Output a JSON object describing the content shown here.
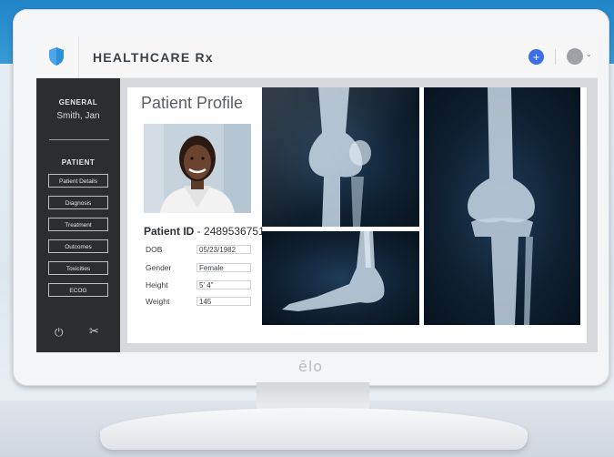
{
  "app": {
    "title": "HEALTHCARE Rx"
  },
  "topbar": {
    "add_icon": "plus-icon",
    "add_symbol": "+",
    "caret_symbol": "⌄"
  },
  "sidebar": {
    "section_general": "GENERAL",
    "patient_name": "Smith, Jan",
    "section_patient": "PATIENT",
    "items": [
      {
        "label": "Patient Details"
      },
      {
        "label": "Diagnosis"
      },
      {
        "label": "Treatment"
      },
      {
        "label": "Outcomes"
      },
      {
        "label": "Toxicities"
      },
      {
        "label": "ECOG"
      }
    ],
    "power_symbol": "⏻",
    "tools_symbol": "✂"
  },
  "main": {
    "title": "Patient Profile",
    "patient_id_label": "Patient ID",
    "patient_id_sep": " - ",
    "patient_id_value": "2489536751",
    "fields": [
      {
        "label": "DOB",
        "value": "05/23/1982"
      },
      {
        "label": "Gender",
        "value": "Female"
      },
      {
        "label": "Height",
        "value": "5' 4\""
      },
      {
        "label": "Weight",
        "value": "145"
      }
    ]
  },
  "device": {
    "brand": "ēlo"
  },
  "colors": {
    "accent": "#3d6ee8",
    "sidebar_bg": "#2c2d2f",
    "shield": "#4aa6e8"
  }
}
